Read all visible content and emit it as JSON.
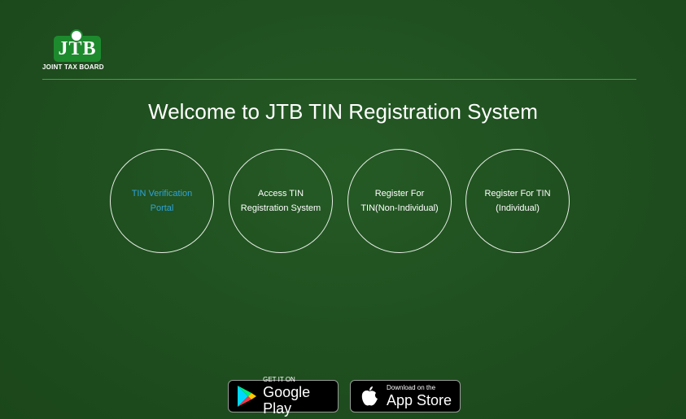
{
  "brand": {
    "logo_letters": "JTB",
    "logo_caption": "JOINT TAX BOARD"
  },
  "main": {
    "title": "Welcome to JTB TIN Registration System",
    "options": [
      {
        "line1": "TIN Verification",
        "line2": "Portal"
      },
      {
        "line1": "Access TIN",
        "line2": "Registration System"
      },
      {
        "line1": "Register For",
        "line2": "TIN(Non-Individual)"
      },
      {
        "line1": "Register For TIN",
        "line2": "(Individual)"
      }
    ]
  },
  "stores": {
    "google": {
      "small": "GET IT ON",
      "big": "Google Play"
    },
    "apple": {
      "small": "Download on the",
      "big": "App Store"
    }
  },
  "colors": {
    "background": "#1f4e1f",
    "divider": "#3aa83a",
    "link": "#2fa3d8",
    "logo_green": "#1d8a2e"
  }
}
